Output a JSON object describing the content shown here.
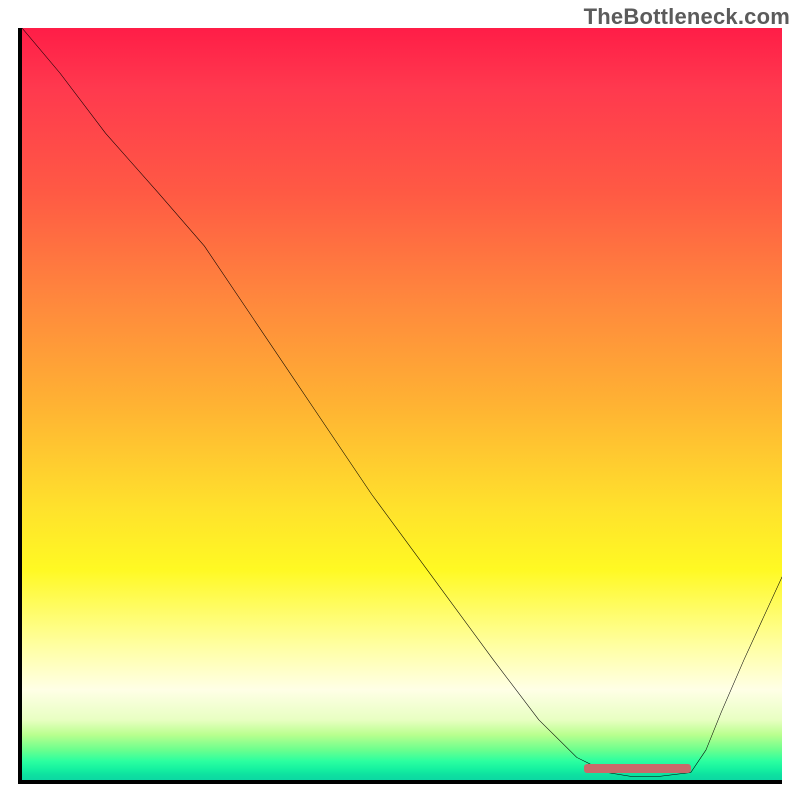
{
  "attribution": "TheBottleneck.com",
  "chart_data": {
    "type": "line",
    "title": "",
    "xlabel": "",
    "ylabel": "",
    "xlim": [
      0,
      100
    ],
    "ylim": [
      0,
      100
    ],
    "x": [
      0,
      5,
      11,
      18,
      24,
      30,
      38,
      46,
      54,
      62,
      68,
      73,
      77,
      80,
      84,
      88,
      90,
      92,
      95,
      100
    ],
    "values": [
      100,
      94,
      86,
      78,
      71,
      62,
      50,
      38,
      27,
      16,
      8,
      3,
      1,
      0.5,
      0.5,
      1,
      4,
      9,
      16,
      27
    ],
    "marker": {
      "x_start": 74,
      "x_end": 88,
      "y": 0.9
    },
    "series_name": "bottleneck-curve"
  },
  "colors": {
    "axis": "#000000",
    "curve": "#000000",
    "marker": "#c96a6a",
    "attribution": "#5b5b5b"
  }
}
